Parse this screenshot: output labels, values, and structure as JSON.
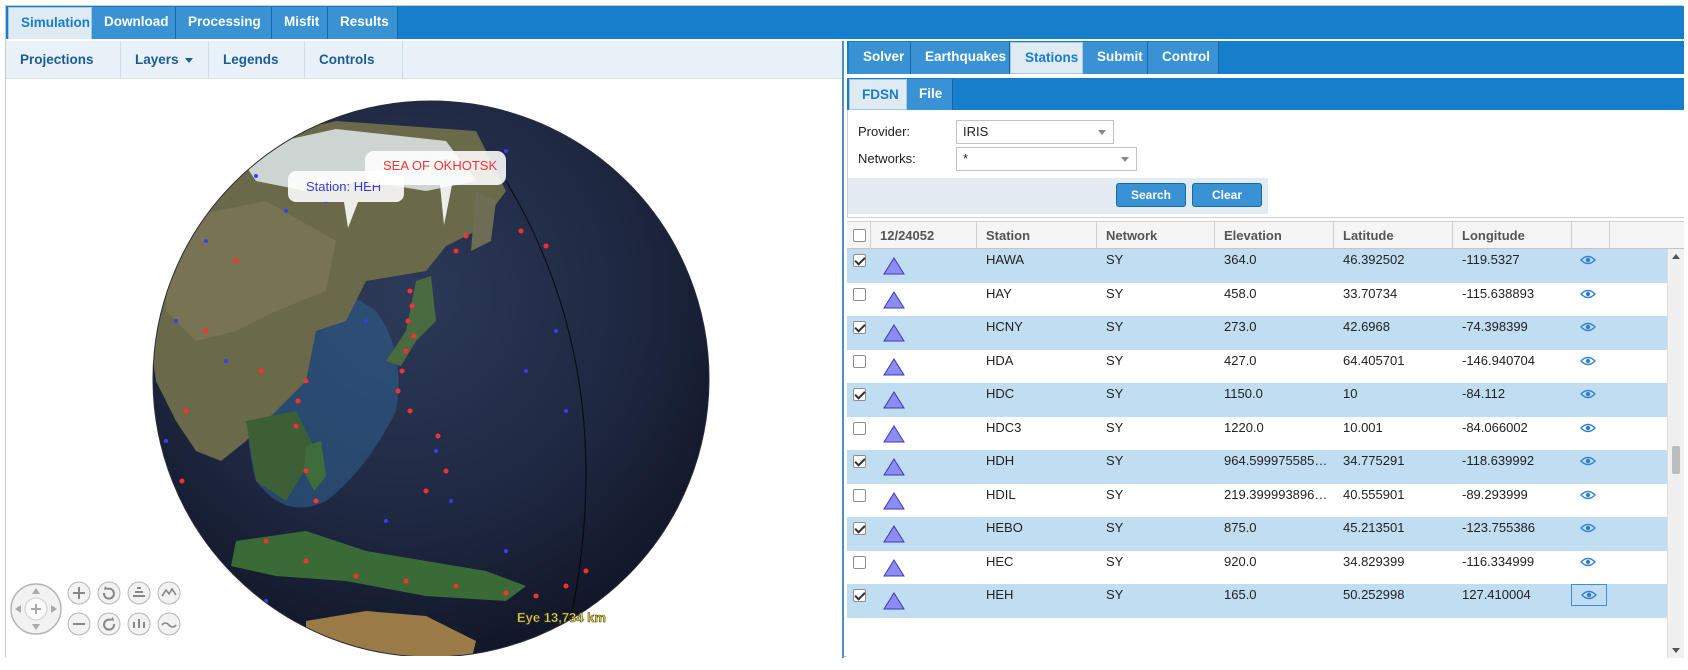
{
  "top_tabs": [
    {
      "label": "Simulation",
      "active": true
    },
    {
      "label": "Download",
      "active": false
    },
    {
      "label": "Processing",
      "active": false
    },
    {
      "label": "Misfit",
      "active": false
    },
    {
      "label": "Results",
      "active": false
    }
  ],
  "map": {
    "menu": [
      "Projections",
      "Layers",
      "Legends",
      "Controls"
    ],
    "labels": {
      "station": "Station: HEH",
      "sea": "SEA OF OKHOTSK"
    },
    "eye_readout": "Eye  13,734 km",
    "colors": {
      "earthquake": "#ff2b2b",
      "station": "#3a3aff",
      "label_station": "#3b3bd6",
      "label_sea": "#ff3030"
    }
  },
  "right": {
    "tabs": [
      "Solver",
      "Earthquakes",
      "Stations",
      "Submit",
      "Control"
    ],
    "active_tab": "Stations",
    "source_tabs": [
      "FDSN",
      "File"
    ],
    "active_source_tab": "FDSN",
    "form": {
      "provider_label": "Provider:",
      "provider_value": "IRIS",
      "networks_label": "Networks:",
      "networks_value": "*",
      "search_label": "Search",
      "clear_label": "Clear"
    },
    "grid": {
      "count_label": "12/24052",
      "columns": [
        "Station",
        "Network",
        "Elevation",
        "Latitude",
        "Longitude"
      ],
      "rows": [
        {
          "checked": true,
          "station": "HAWA",
          "network": "SY",
          "elevation": "364.0",
          "latitude": "46.392502",
          "longitude": "-119.5327"
        },
        {
          "checked": false,
          "station": "HAY",
          "network": "SY",
          "elevation": "458.0",
          "latitude": "33.70734",
          "longitude": "-115.638893"
        },
        {
          "checked": true,
          "station": "HCNY",
          "network": "SY",
          "elevation": "273.0",
          "latitude": "42.6968",
          "longitude": "-74.398399"
        },
        {
          "checked": false,
          "station": "HDA",
          "network": "SY",
          "elevation": "427.0",
          "latitude": "64.405701",
          "longitude": "-146.940704"
        },
        {
          "checked": true,
          "station": "HDC",
          "network": "SY",
          "elevation": "1150.0",
          "latitude": "10",
          "longitude": "-84.112"
        },
        {
          "checked": false,
          "station": "HDC3",
          "network": "SY",
          "elevation": "1220.0",
          "latitude": "10.001",
          "longitude": "-84.066002"
        },
        {
          "checked": true,
          "station": "HDH",
          "network": "SY",
          "elevation": "964.599975585…",
          "latitude": "34.775291",
          "longitude": "-118.639992"
        },
        {
          "checked": false,
          "station": "HDIL",
          "network": "SY",
          "elevation": "219.399993896…",
          "latitude": "40.555901",
          "longitude": "-89.293999"
        },
        {
          "checked": true,
          "station": "HEBO",
          "network": "SY",
          "elevation": "875.0",
          "latitude": "45.213501",
          "longitude": "-123.755386"
        },
        {
          "checked": false,
          "station": "HEC",
          "network": "SY",
          "elevation": "920.0",
          "latitude": "34.829399",
          "longitude": "-116.334999"
        },
        {
          "checked": true,
          "station": "HEH",
          "network": "SY",
          "elevation": "165.0",
          "latitude": "50.252998",
          "longitude": "127.410004"
        }
      ]
    }
  }
}
